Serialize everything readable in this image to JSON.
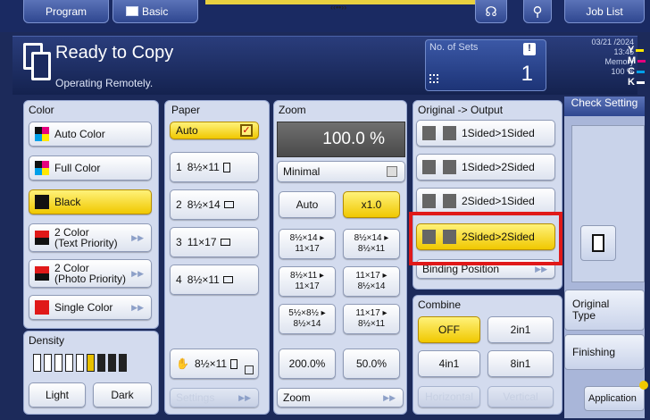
{
  "topbar": {
    "program": "Program",
    "basic": "Basic",
    "job_list": "Job List"
  },
  "header": {
    "status": "Ready to Copy",
    "sub": "Operating Remotely.",
    "sets_label": "No. of Sets",
    "sets_value": "1",
    "date": "03/21 /2024",
    "time": "13:45",
    "memory_label": "Memory",
    "memory_value": "100 %",
    "cmyk": [
      "Y",
      "M",
      "C",
      "K"
    ]
  },
  "color": {
    "title": "Color",
    "items": [
      "Auto Color",
      "Full Color",
      "Black",
      "2 Color\n(Text Priority)",
      "2 Color\n(Photo Priority)",
      "Single Color"
    ],
    "selected": "Black"
  },
  "density": {
    "title": "Density",
    "light": "Light",
    "dark": "Dark",
    "level": 6,
    "levels": 9
  },
  "paper": {
    "title": "Paper",
    "auto": "Auto",
    "trays": [
      {
        "num": "1",
        "size": "8½×11"
      },
      {
        "num": "2",
        "size": "8½×14"
      },
      {
        "num": "3",
        "size": "11×17"
      },
      {
        "num": "4",
        "size": "8½×11"
      }
    ],
    "bypass": "8½×11",
    "settings": "Settings"
  },
  "zoom": {
    "title": "Zoom",
    "value": "100.0 %",
    "minimal": "Minimal",
    "auto": "Auto",
    "x1": "x1.0",
    "presets": [
      [
        "8½×14 ▸\n11×17",
        "8½×14 ▸\n8½×11"
      ],
      [
        "8½×11 ▸\n11×17",
        "11×17 ▸\n8½×14"
      ],
      [
        "5½×8½ ▸\n8½×14",
        "11×17 ▸\n8½×11"
      ]
    ],
    "p200": "200.0%",
    "p50": "50.0%",
    "footer": "Zoom"
  },
  "output": {
    "title": "Original -> Output",
    "items": [
      "1Sided>1Sided",
      "1Sided>2Sided",
      "2Sided>1Sided",
      "2Sided>2Sided"
    ],
    "selected": "2Sided>2Sided",
    "binding": "Binding Position"
  },
  "combine": {
    "title": "Combine",
    "off": "OFF",
    "c2": "2in1",
    "c4": "4in1",
    "c8": "8in1",
    "horizontal": "Horizontal",
    "vertical": "Vertical"
  },
  "right": {
    "check": "Check Setting",
    "original_type": "Original\nType",
    "finishing": "Finishing",
    "application": "Application"
  }
}
